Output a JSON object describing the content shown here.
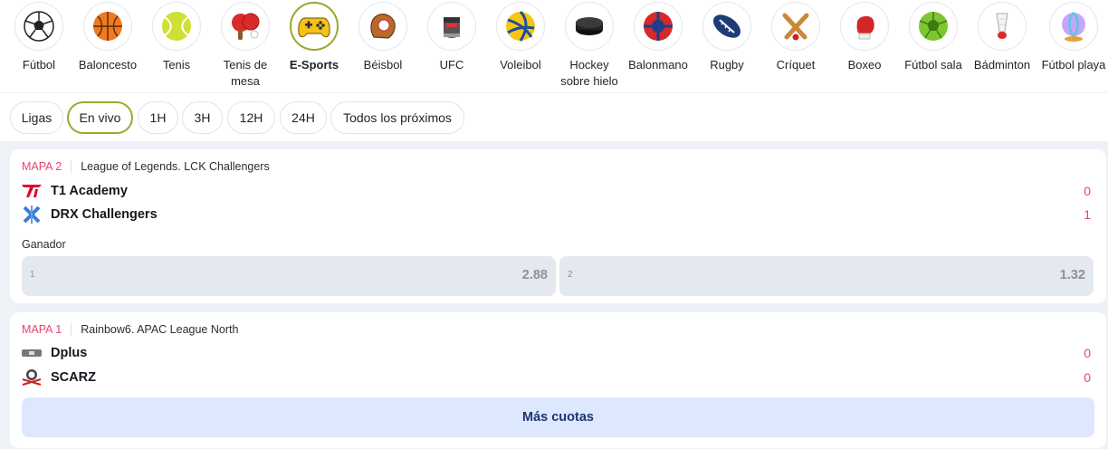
{
  "sports": [
    {
      "label": "Fútbol",
      "icon": "soccer-ball-icon"
    },
    {
      "label": "Baloncesto",
      "icon": "basketball-icon"
    },
    {
      "label": "Tenis",
      "icon": "tennis-ball-icon"
    },
    {
      "label": "Tenis de mesa",
      "icon": "ping-pong-icon"
    },
    {
      "label": "E-Sports",
      "icon": "gamepad-icon",
      "active": true
    },
    {
      "label": "Béisbol",
      "icon": "baseball-glove-icon"
    },
    {
      "label": "UFC",
      "icon": "mma-glove-icon"
    },
    {
      "label": "Voleibol",
      "icon": "volleyball-icon"
    },
    {
      "label": "Hockey sobre hielo",
      "icon": "hockey-puck-icon"
    },
    {
      "label": "Balonmano",
      "icon": "handball-icon"
    },
    {
      "label": "Rugby",
      "icon": "rugby-ball-icon"
    },
    {
      "label": "Críquet",
      "icon": "cricket-bats-icon"
    },
    {
      "label": "Boxeo",
      "icon": "boxing-glove-icon"
    },
    {
      "label": "Fútbol sala",
      "icon": "futsal-ball-icon"
    },
    {
      "label": "Bádminton",
      "icon": "shuttlecock-icon"
    },
    {
      "label": "Fútbol playa",
      "icon": "beach-ball-icon"
    }
  ],
  "filters": [
    {
      "label": "Ligas"
    },
    {
      "label": "En vivo",
      "active": true
    },
    {
      "label": "1H"
    },
    {
      "label": "3H"
    },
    {
      "label": "12H"
    },
    {
      "label": "24H"
    },
    {
      "label": "Todos los próximos"
    }
  ],
  "matches": [
    {
      "map": "MAPA 2",
      "league": "League of Legends. LCK Challengers",
      "team1": {
        "name": "T1 Academy",
        "score": "0",
        "logo": "t1-logo-icon"
      },
      "team2": {
        "name": "DRX Challengers",
        "score": "1",
        "logo": "drx-logo-icon"
      },
      "market": "Ganador",
      "odds": [
        {
          "num": "1",
          "value": "2.88"
        },
        {
          "num": "2",
          "value": "1.32"
        }
      ]
    },
    {
      "map": "MAPA 1",
      "league": "Rainbow6. APAC League North",
      "team1": {
        "name": "Dplus",
        "score": "0",
        "logo": "dplus-logo-icon"
      },
      "team2": {
        "name": "SCARZ",
        "score": "0",
        "logo": "scarz-logo-icon"
      },
      "more_label": "Más cuotas"
    }
  ],
  "colors": {
    "accent": "#a0a62d",
    "score": "#e8456e",
    "more_text": "#1d3470",
    "more_bg": "#dde7fd"
  }
}
